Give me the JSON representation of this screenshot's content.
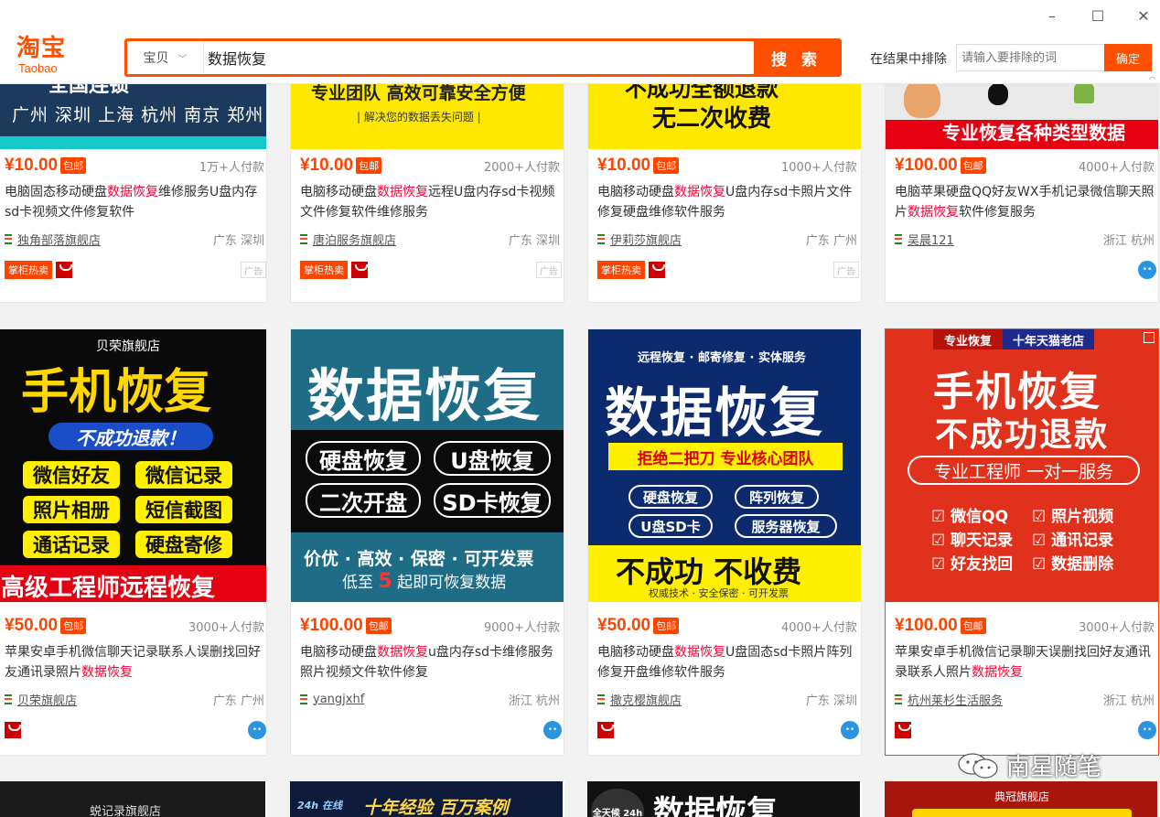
{
  "window": {
    "minimize": "–",
    "maximize": "☐",
    "close": "✕"
  },
  "header": {
    "logo_cn": "淘宝",
    "logo_en": "Taobao",
    "search_type": "宝贝",
    "search_value": "数据恢复",
    "search_button": "搜 索",
    "exclude_label": "在结果中排除",
    "exclude_placeholder": "请输入要排除的词",
    "exclude_button": "确定"
  },
  "colors": {
    "accent": "#ff5000",
    "highlight": "#ff0036",
    "tmall": "#cc0000",
    "wangwang": "#2b94e0"
  },
  "row1": [
    {
      "banner": [
        "全国连锁",
        "广州 深圳 上海 杭州 南京 郑州"
      ],
      "price": "¥10.00",
      "badge": "包邮",
      "paid": "1万+人付款",
      "title_pre": "电脑固态移动硬盘",
      "title_hl": "数据恢复",
      "title_post": "维修服务U盘内存sd卡视频文件修复软件",
      "shop": "独角部落旗舰店",
      "location": "广东 深圳",
      "tag": "掌柜热卖",
      "ad": "广告"
    },
    {
      "banner": [
        "专业团队 高效可靠安全方便",
        "| 解决您的数据丢失问题 |"
      ],
      "price": "¥10.00",
      "badge": "包邮",
      "paid": "2000+人付款",
      "title_pre": "电脑移动硬盘",
      "title_hl": "数据恢复",
      "title_post": "远程U盘内存sd卡视频文件修复软件维修服务",
      "shop": "唐泊服务旗舰店",
      "location": "广东 深圳",
      "tag": "掌柜热卖",
      "ad": "广告"
    },
    {
      "banner": [
        "不成功全额退款",
        "无二次收费"
      ],
      "price": "¥10.00",
      "badge": "包邮",
      "paid": "1000+人付款",
      "title_pre": "电脑移动硬盘",
      "title_hl": "数据恢复",
      "title_post": "U盘内存sd卡照片文件修复硬盘维修软件服务",
      "shop": "伊莉莎旗舰店",
      "location": "广东 广州",
      "tag": "掌柜热卖",
      "ad": "广告"
    },
    {
      "banner": [
        "专业恢复各种类型数据"
      ],
      "price": "¥100.00",
      "badge": "包邮",
      "paid": "4000+人付款",
      "title_pre": "电脑苹果硬盘QQ好友WX手机记录微信聊天照片",
      "title_hl": "数据恢复",
      "title_post": "软件修复服务",
      "shop": "吴晨121",
      "location": "浙江 杭州"
    }
  ],
  "row2": [
    {
      "banner": {
        "store": "贝荣旗舰店",
        "headline": "手机恢复",
        "slogan": "不成功退款！",
        "items": [
          "微信好友",
          "微信记录",
          "照片相册",
          "短信截图",
          "通话记录",
          "硬盘寄修"
        ],
        "footer": "高级工程师远程恢复"
      },
      "price": "¥50.00",
      "badge": "包邮",
      "paid": "3000+人付款",
      "title_pre": "苹果安卓手机微信聊天记录联系人误删找回好友通讯录照片",
      "title_hl": "数据恢复",
      "title_post": "",
      "shop": "贝荣旗舰店",
      "location": "广东 广州"
    },
    {
      "banner": {
        "headline": "数据恢复",
        "items": [
          "硬盘恢复",
          "U盘恢复",
          "二次开盘",
          "SD卡恢复"
        ],
        "footer1": "价优 · 高效 · 保密 · 可开发票",
        "footer2_pre": "低至",
        "footer2_num": "5",
        "footer2_post": "起即可恢复数据"
      },
      "price": "¥100.00",
      "badge": "包邮",
      "paid": "9000+人付款",
      "title_pre": "电脑移动硬盘",
      "title_hl": "数据恢复",
      "title_post": "u盘内存sd卡维修服务照片视频文件软件修复",
      "shop": "yangjxhf",
      "location": "浙江 杭州"
    },
    {
      "banner": {
        "top": "远程恢复 · 邮寄修复 · 实体服务",
        "headline": "数据恢复",
        "slogan": "拒绝二把刀  专业核心团队",
        "items": [
          "硬盘恢复",
          "阵列恢复",
          "U盘SD卡",
          "服务器恢复"
        ],
        "footer": "不成功 不收费",
        "footer2": "权威技术 · 安全保密 · 可开发票"
      },
      "price": "¥50.00",
      "badge": "包邮",
      "paid": "4000+人付款",
      "title_pre": "电脑移动硬盘",
      "title_hl": "数据恢复",
      "title_post": "U盘固态sd卡照片阵列修复开盘维修软件服务",
      "shop": "撒克樱旗舰店",
      "location": "广东 深圳"
    },
    {
      "banner": {
        "tag1": "专业恢复",
        "tag2": "十年天猫老店",
        "headline1": "手机恢复",
        "headline2": "不成功退款",
        "slogan": "专业工程师 一对一服务",
        "items": [
          "微信QQ",
          "照片视频",
          "聊天记录",
          "通讯记录",
          "好友找回",
          "数据删除"
        ]
      },
      "price": "¥100.00",
      "badge": "包邮",
      "paid": "3000+人付款",
      "title_pre": "苹果安卓手机微信记录聊天误删找回好友通讯录联系人照片",
      "title_hl": "数据恢复",
      "title_post": "",
      "shop": "杭州莱杉生活服务",
      "location": "浙江 杭州"
    }
  ],
  "row3": [
    {
      "banner": "蜕记录旗舰店"
    },
    {
      "banner": "十年经验 百万案例",
      "badge": "24h 在线"
    },
    {
      "banner": "数据恢复",
      "badge": "全天候 24h"
    },
    {
      "banner": "典冠旗舰店"
    }
  ],
  "watermark": "南星随笔"
}
